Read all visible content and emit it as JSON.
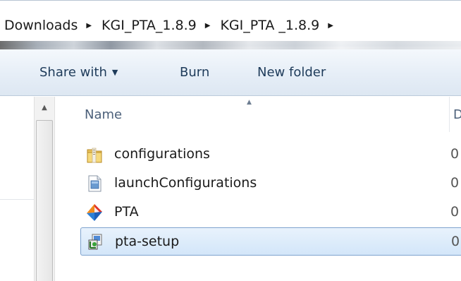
{
  "breadcrumb": {
    "items": [
      "Downloads",
      "KGI_PTA_1.8.9",
      "KGI_PTA _1.8.9"
    ],
    "separator": "▶"
  },
  "toolbar": {
    "share_label": "Share with",
    "share_caret": "▼",
    "burn_label": "Burn",
    "new_folder_label": "New folder"
  },
  "scrollbar": {
    "up_glyph": "▲"
  },
  "columns": {
    "name_header": "Name",
    "sort_glyph": "▲",
    "date_header": "D"
  },
  "files": [
    {
      "name": "configurations",
      "icon": "folder-icon",
      "date": "0",
      "selected": false
    },
    {
      "name": "launchConfigurations",
      "icon": "document-icon",
      "date": "0",
      "selected": false
    },
    {
      "name": "PTA",
      "icon": "pta-app-icon",
      "date": "0",
      "selected": false
    },
    {
      "name": "pta-setup",
      "icon": "installer-icon",
      "date": "0",
      "selected": true
    }
  ],
  "colors": {
    "toolbar_text": "#1e3b5a",
    "header_text": "#4c607a",
    "selection_border": "#7da2ce",
    "selection_fill": "#d3e6f9"
  }
}
